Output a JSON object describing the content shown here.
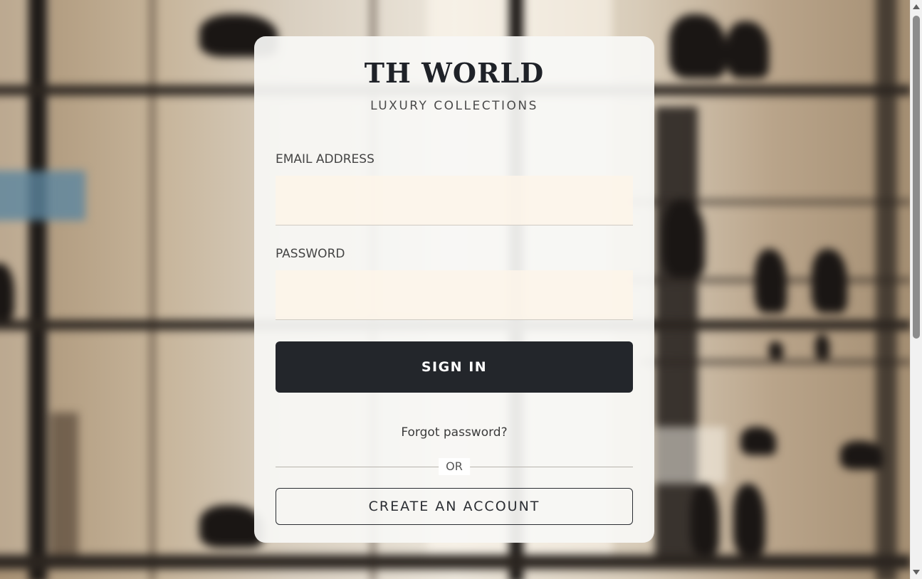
{
  "brand": {
    "title": "TH WORLD",
    "subtitle": "LUXURY COLLECTIONS"
  },
  "form": {
    "email_label": "EMAIL ADDRESS",
    "email_value": "",
    "password_label": "PASSWORD",
    "password_value": "",
    "signin_label": "SIGN IN",
    "forgot_label": "Forgot password?",
    "divider_label": "OR",
    "create_account_label": "CREATE AN ACCOUNT"
  },
  "colors": {
    "button_dark": "#23262b",
    "input_background": "#fdf4e9",
    "card_background": "#f8f7f5"
  }
}
